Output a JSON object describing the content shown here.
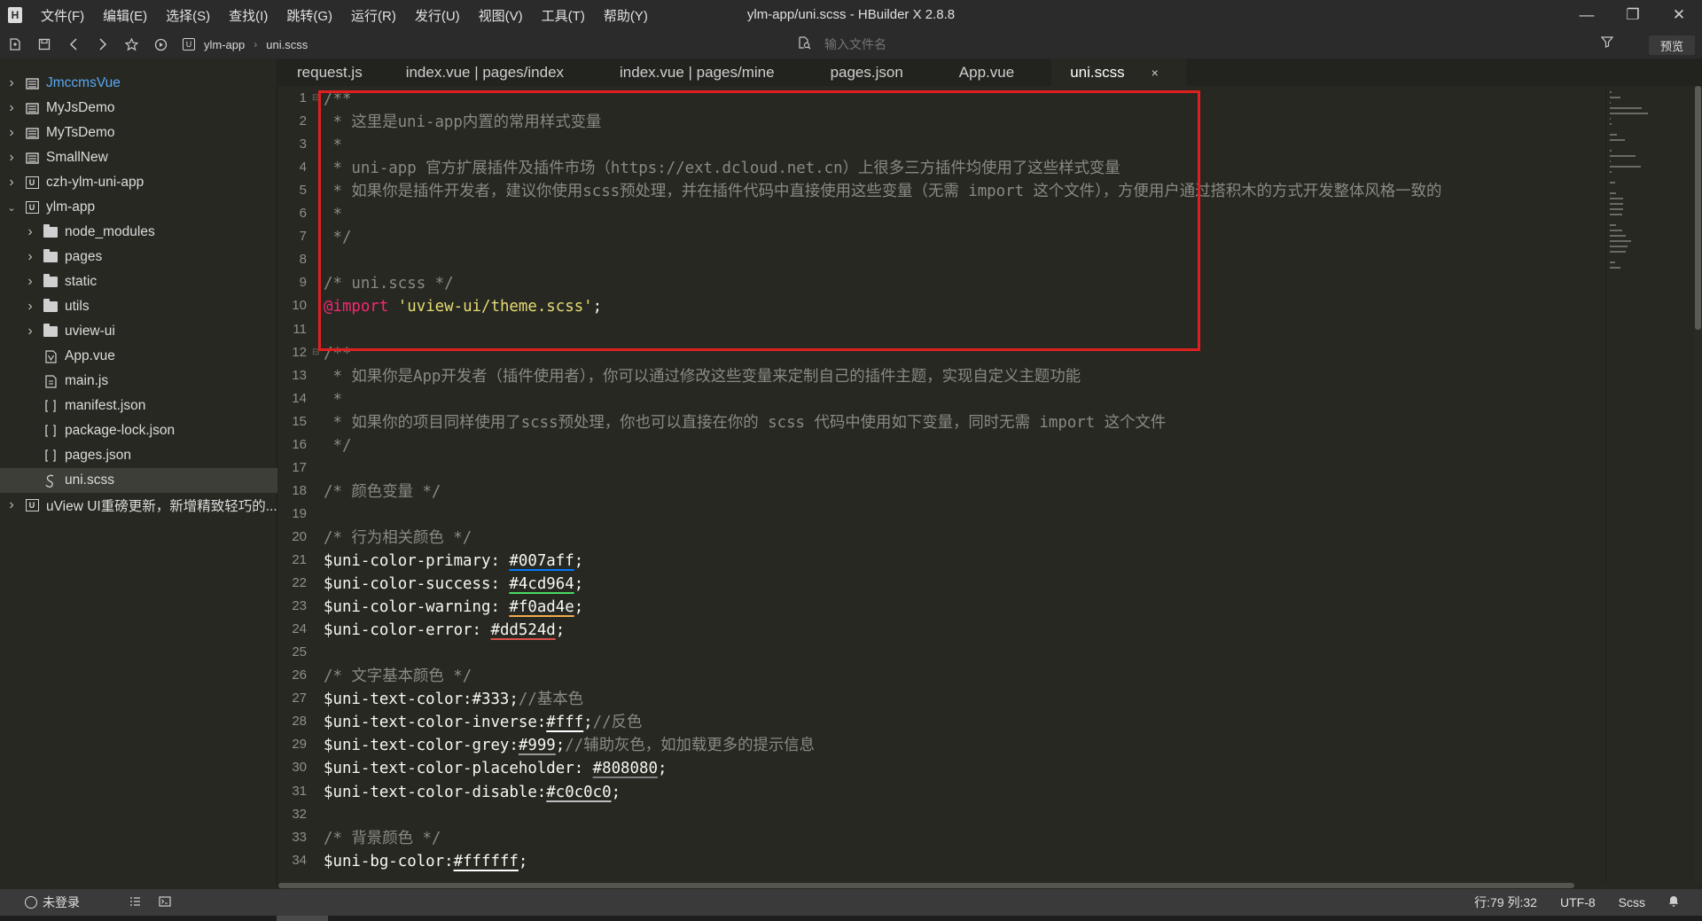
{
  "menu": [
    "文件(F)",
    "编辑(E)",
    "选择(S)",
    "查找(I)",
    "跳转(G)",
    "运行(R)",
    "发行(U)",
    "视图(V)",
    "工具(T)",
    "帮助(Y)"
  ],
  "window_title": "ylm-app/uni.scss - HBuilder X 2.8.8",
  "window_controls": {
    "minimize": "—",
    "restore": "❐",
    "close": "✕"
  },
  "toolbar": {
    "breadcrumb": [
      "ylm-app",
      "uni.scss"
    ],
    "search_placeholder": "输入文件名",
    "preview_label": "预览"
  },
  "sidebar": {
    "items": [
      {
        "label": "JmccmsVue",
        "type": "project",
        "level": 0,
        "expanded": false,
        "link": true
      },
      {
        "label": "MyJsDemo",
        "type": "project",
        "level": 0,
        "expanded": false
      },
      {
        "label": "MyTsDemo",
        "type": "project",
        "level": 0,
        "expanded": false
      },
      {
        "label": "SmallNew",
        "type": "project",
        "level": 0,
        "expanded": false
      },
      {
        "label": "czh-ylm-uni-app",
        "type": "uniproject",
        "level": 0,
        "expanded": false
      },
      {
        "label": "ylm-app",
        "type": "uniproject",
        "level": 0,
        "expanded": true
      },
      {
        "label": "node_modules",
        "type": "folder",
        "level": 1,
        "expanded": false
      },
      {
        "label": "pages",
        "type": "folder",
        "level": 1,
        "expanded": false
      },
      {
        "label": "static",
        "type": "folder",
        "level": 1,
        "expanded": false
      },
      {
        "label": "utils",
        "type": "folder",
        "level": 1,
        "expanded": false
      },
      {
        "label": "uview-ui",
        "type": "folder",
        "level": 1,
        "expanded": false
      },
      {
        "label": "App.vue",
        "type": "vue",
        "level": 1
      },
      {
        "label": "main.js",
        "type": "js",
        "level": 1
      },
      {
        "label": "manifest.json",
        "type": "json",
        "level": 1
      },
      {
        "label": "package-lock.json",
        "type": "json",
        "level": 1
      },
      {
        "label": "pages.json",
        "type": "json",
        "level": 1
      },
      {
        "label": "uni.scss",
        "type": "scss",
        "level": 1,
        "selected": true
      },
      {
        "label": "uView UI重磅更新，新增精致轻巧的...",
        "type": "uniproject",
        "level": 0,
        "expanded": false
      }
    ]
  },
  "tabs": [
    {
      "label": "request.js"
    },
    {
      "label": "index.vue | pages/index"
    },
    {
      "label": "index.vue | pages/mine"
    },
    {
      "label": "pages.json"
    },
    {
      "label": "App.vue"
    },
    {
      "label": "uni.scss",
      "active": true,
      "close": "×"
    }
  ],
  "code_lines": [
    {
      "n": "1",
      "fold": true,
      "parts": [
        {
          "t": "/**",
          "c": "comment"
        }
      ]
    },
    {
      "n": "2",
      "parts": [
        {
          "t": " * 这里是uni-app内置的常用样式变量",
          "c": "comment"
        }
      ]
    },
    {
      "n": "3",
      "parts": [
        {
          "t": " *",
          "c": "comment"
        }
      ]
    },
    {
      "n": "4",
      "parts": [
        {
          "t": " * uni-app 官方扩展插件及插件市场（https://ext.dcloud.net.cn）上很多三方插件均使用了这些样式变量",
          "c": "comment"
        }
      ]
    },
    {
      "n": "5",
      "parts": [
        {
          "t": " * 如果你是插件开发者，建议你使用scss预处理，并在插件代码中直接使用这些变量（无需 import 这个文件），方便用户通过搭积木的方式开发整体风格一致的",
          "c": "comment"
        }
      ]
    },
    {
      "n": "6",
      "parts": [
        {
          "t": " *",
          "c": "comment"
        }
      ]
    },
    {
      "n": "7",
      "parts": [
        {
          "t": " */",
          "c": "comment"
        }
      ]
    },
    {
      "n": "8",
      "parts": []
    },
    {
      "n": "9",
      "parts": [
        {
          "t": "/* uni.scss */",
          "c": "comment"
        }
      ]
    },
    {
      "n": "10",
      "parts": [
        {
          "t": "@import",
          "c": "at"
        },
        {
          "t": " ",
          "c": "var"
        },
        {
          "t": "'uview-ui/theme.scss'",
          "c": "str"
        },
        {
          "t": ";",
          "c": "var"
        }
      ]
    },
    {
      "n": "11",
      "parts": []
    },
    {
      "n": "12",
      "fold": true,
      "parts": [
        {
          "t": "/**",
          "c": "comment"
        }
      ]
    },
    {
      "n": "13",
      "parts": [
        {
          "t": " * 如果你是App开发者（插件使用者），你可以通过修改这些变量来定制自己的插件主题，实现自定义主题功能",
          "c": "comment"
        }
      ]
    },
    {
      "n": "14",
      "parts": [
        {
          "t": " *",
          "c": "comment"
        }
      ]
    },
    {
      "n": "15",
      "parts": [
        {
          "t": " * 如果你的项目同样使用了scss预处理，你也可以直接在你的 scss 代码中使用如下变量，同时无需 import 这个文件",
          "c": "comment"
        }
      ]
    },
    {
      "n": "16",
      "parts": [
        {
          "t": " */",
          "c": "comment"
        }
      ]
    },
    {
      "n": "17",
      "parts": []
    },
    {
      "n": "18",
      "parts": [
        {
          "t": "/* 颜色变量 */",
          "c": "comment"
        }
      ]
    },
    {
      "n": "19",
      "parts": []
    },
    {
      "n": "20",
      "parts": [
        {
          "t": "/* 行为相关颜色 */",
          "c": "comment"
        }
      ]
    },
    {
      "n": "21",
      "parts": [
        {
          "t": "$uni-color-primary: ",
          "c": "var"
        },
        {
          "t": "#007aff",
          "c": "val",
          "u": "#007aff"
        },
        {
          "t": ";",
          "c": "var"
        }
      ]
    },
    {
      "n": "22",
      "parts": [
        {
          "t": "$uni-color-success: ",
          "c": "var"
        },
        {
          "t": "#4cd964",
          "c": "val",
          "u": "#4cd964"
        },
        {
          "t": ";",
          "c": "var"
        }
      ]
    },
    {
      "n": "23",
      "parts": [
        {
          "t": "$uni-color-warning: ",
          "c": "var"
        },
        {
          "t": "#f0ad4e",
          "c": "val",
          "u": "#f0ad4e"
        },
        {
          "t": ";",
          "c": "var"
        }
      ]
    },
    {
      "n": "24",
      "parts": [
        {
          "t": "$uni-color-error: ",
          "c": "var"
        },
        {
          "t": "#dd524d",
          "c": "val",
          "u": "#dd524d"
        },
        {
          "t": ";",
          "c": "var"
        }
      ]
    },
    {
      "n": "25",
      "parts": []
    },
    {
      "n": "26",
      "parts": [
        {
          "t": "/* 文字基本颜色 */",
          "c": "comment"
        }
      ]
    },
    {
      "n": "27",
      "parts": [
        {
          "t": "$uni-text-color:#333;",
          "c": "var"
        },
        {
          "t": "//基本色",
          "c": "comment"
        }
      ]
    },
    {
      "n": "28",
      "parts": [
        {
          "t": "$uni-text-color-inverse:",
          "c": "var"
        },
        {
          "t": "#fff",
          "c": "val",
          "u": "#ffffff"
        },
        {
          "t": ";",
          "c": "var"
        },
        {
          "t": "//反色",
          "c": "comment"
        }
      ]
    },
    {
      "n": "29",
      "parts": [
        {
          "t": "$uni-text-color-grey:",
          "c": "var"
        },
        {
          "t": "#999",
          "c": "val",
          "u": "#999999"
        },
        {
          "t": ";",
          "c": "var"
        },
        {
          "t": "//辅助灰色，如加载更多的提示信息",
          "c": "comment"
        }
      ]
    },
    {
      "n": "30",
      "parts": [
        {
          "t": "$uni-text-color-placeholder: ",
          "c": "var"
        },
        {
          "t": "#808080",
          "c": "val",
          "u": "#808080"
        },
        {
          "t": ";",
          "c": "var"
        }
      ]
    },
    {
      "n": "31",
      "parts": [
        {
          "t": "$uni-text-color-disable:",
          "c": "var"
        },
        {
          "t": "#c0c0c0",
          "c": "val",
          "u": "#c0c0c0"
        },
        {
          "t": ";",
          "c": "var"
        }
      ]
    },
    {
      "n": "32",
      "parts": []
    },
    {
      "n": "33",
      "parts": [
        {
          "t": "/* 背景颜色 */",
          "c": "comment"
        }
      ]
    },
    {
      "n": "34",
      "parts": [
        {
          "t": "$uni-bg-color:",
          "c": "var"
        },
        {
          "t": "#ffffff",
          "c": "val",
          "u": "#ffffff"
        },
        {
          "t": ";",
          "c": "var"
        }
      ]
    }
  ],
  "colors": {
    "editor_bg": "#272822",
    "comment": "#8a8a80",
    "keyword_at": "#f92672",
    "string": "#e6db74",
    "highlight_box": "#e02020",
    "link": "#5aa7f0"
  },
  "statusbar": {
    "login": "未登录",
    "position": "行:79  列:32",
    "encoding": "UTF-8",
    "language": "Scss"
  }
}
